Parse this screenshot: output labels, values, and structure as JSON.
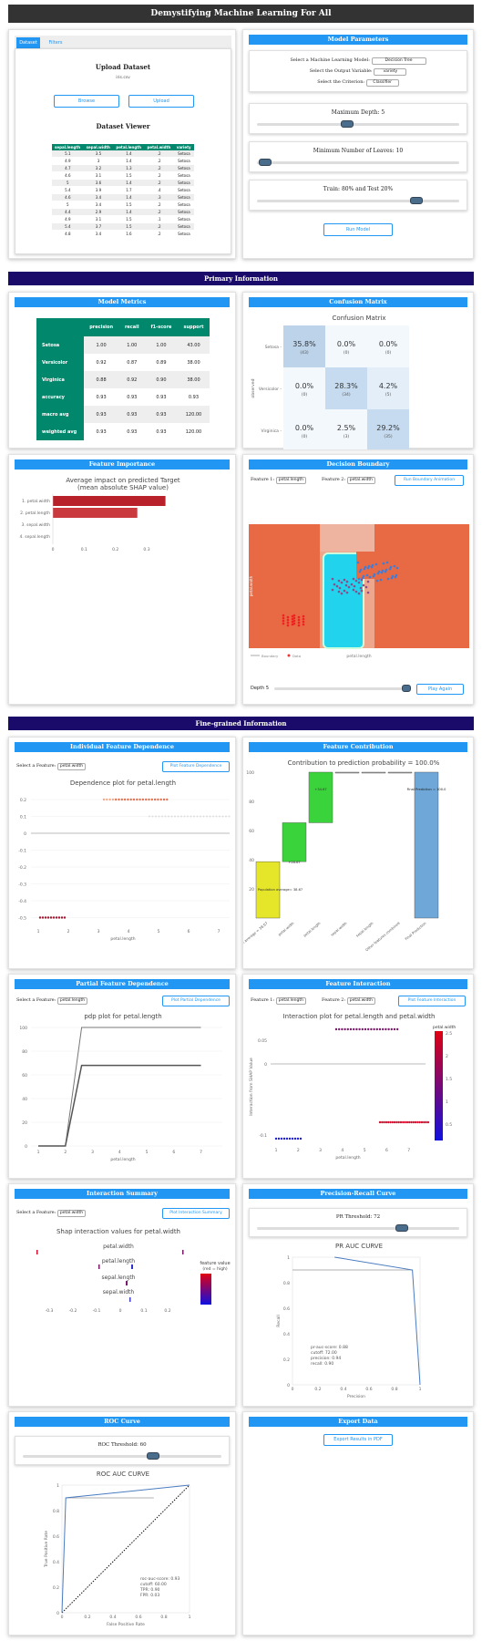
{
  "app": {
    "title": "Demystifying Machine Learning For All"
  },
  "sections": {
    "primary": "Primary Information",
    "fine": "Fine-grained Information"
  },
  "dataset": {
    "tab_dataset": "Dataset",
    "tab_filters": "Filters",
    "upload_title": "Upload Dataset",
    "filename": "iris.csv",
    "browse": "Browse",
    "upload": "Upload",
    "viewer_title": "Dataset Viewer",
    "columns": [
      "sepal.length",
      "sepal.width",
      "petal.length",
      "petal.width",
      "variety"
    ],
    "rows": [
      [
        "5.1",
        "3.5",
        "1.4",
        ".2",
        "Setosa"
      ],
      [
        "4.9",
        "3",
        "1.4",
        ".2",
        "Setosa"
      ],
      [
        "4.7",
        "3.2",
        "1.3",
        ".2",
        "Setosa"
      ],
      [
        "4.6",
        "3.1",
        "1.5",
        ".2",
        "Setosa"
      ],
      [
        "5",
        "3.6",
        "1.4",
        ".2",
        "Setosa"
      ],
      [
        "5.4",
        "3.9",
        "1.7",
        ".4",
        "Setosa"
      ],
      [
        "4.6",
        "3.4",
        "1.4",
        ".3",
        "Setosa"
      ],
      [
        "5",
        "3.4",
        "1.5",
        ".2",
        "Setosa"
      ],
      [
        "4.4",
        "2.9",
        "1.4",
        ".2",
        "Setosa"
      ],
      [
        "4.9",
        "3.1",
        "1.5",
        ".1",
        "Setosa"
      ],
      [
        "5.4",
        "3.7",
        "1.5",
        ".2",
        "Setosa"
      ],
      [
        "4.8",
        "3.4",
        "1.6",
        ".2",
        "Setosa"
      ]
    ]
  },
  "params": {
    "title": "Model Parameters",
    "model_label": "Select a Machine Learning Model:",
    "model_value": "Decision Tree",
    "output_label": "Select the Output Variable:",
    "output_value": "variety",
    "criterion_label": "Select the Criterion:",
    "criterion_value": "Classifier",
    "depth_label": "Maximum Depth: 5",
    "leaves_label": "Minimum Number of Leaves: 10",
    "split_label": "Train: 80% and Test 20%",
    "run": "Run Model",
    "depth_value": 5,
    "leaves_value": 10,
    "train_pct": 80
  },
  "metrics": {
    "title": "Model Metrics",
    "headers": [
      "",
      "precision",
      "recall",
      "f1-score",
      "support"
    ],
    "rows": [
      [
        "Setosa",
        "1.00",
        "1.00",
        "1.00",
        "43.00"
      ],
      [
        "Versicolor",
        "0.92",
        "0.87",
        "0.89",
        "38.00"
      ],
      [
        "Virginica",
        "0.88",
        "0.92",
        "0.90",
        "38.00"
      ],
      [
        "accuracy",
        "0.93",
        "0.93",
        "0.93",
        "0.93"
      ],
      [
        "macro avg",
        "0.93",
        "0.93",
        "0.93",
        "120.00"
      ],
      [
        "weighted avg",
        "0.93",
        "0.93",
        "0.93",
        "120.00"
      ]
    ]
  },
  "confusion": {
    "title": "Confusion Matrix",
    "chart_title": "Confusion Matrix",
    "ylabel": "observed",
    "xlabel": "predicted",
    "labels": [
      "Setosa",
      "Versicolor",
      "Virginica"
    ],
    "cells": [
      [
        "35.8%",
        "(43)",
        "0.0%",
        "(0)",
        "0.0%",
        "(0)"
      ],
      [
        "0.0%",
        "(0)",
        "28.3%",
        "(34)",
        "4.2%",
        "(5)"
      ],
      [
        "0.0%",
        "(0)",
        "2.5%",
        "(3)",
        "29.2%",
        "(35)"
      ]
    ]
  },
  "importance": {
    "title": "Feature Importance",
    "chart_title1": "Average impact on predicted Target",
    "chart_title2": "(mean absolute SHAP value)",
    "features": [
      "1. petal.width",
      "2. petal.length",
      "3. sepal.width",
      "4. sepal.length"
    ],
    "ticks": [
      "0",
      "0.1",
      "0.2",
      "0.3"
    ]
  },
  "boundary": {
    "title": "Decision Boundary",
    "f1_label": "Feature 1:",
    "f1_value": "petal.length",
    "f2_label": "Feature 2:",
    "f2_value": "petal.width",
    "run_anim": "Run Boundary Animation",
    "ylabel": "petal.width",
    "xlabel": "petal.length",
    "legend1": "Boundary",
    "legend2": "Data",
    "depth_label": "Depth 5",
    "play": "Play Again"
  },
  "dependence": {
    "title": "Individual Feature Dependence",
    "select_label": "Select a Feature:",
    "select_value": "petal.width",
    "plot_btn": "Plot Feature Dependence",
    "chart_title": "Dependence plot for petal.length",
    "xlabel": "petal.length",
    "yticks": [
      "0.2",
      "0.1",
      "0",
      "-0.1",
      "-0.2",
      "-0.3",
      "-0.4",
      "-0.5"
    ],
    "xticks": [
      "1",
      "2",
      "3",
      "4",
      "5",
      "6",
      "7"
    ]
  },
  "contribution": {
    "title": "Feature Contribution",
    "chart_title": "Contribution to prediction probability = 100.0%",
    "yticks": [
      "100",
      "80",
      "60",
      "40",
      "20"
    ],
    "bars": [
      "Population average = 38.67",
      "petal.width",
      "petal.length",
      "sepal.width",
      "sepal.length",
      "Other features combined",
      "Final Prediction"
    ],
    "inlabels": [
      "Population average= 38.67",
      "+26.67",
      "+34.67",
      "Final Prediction = 100.0"
    ]
  },
  "pdp": {
    "title": "Partial Feature Dependence",
    "select_label": "Select a Feature:",
    "select_value": "petal.length",
    "plot_btn": "Plot Partial Dependence",
    "chart_title": "pdp plot for petal.length",
    "xlabel": "petal.length",
    "yticks": [
      "100",
      "80",
      "60",
      "40",
      "20",
      "0"
    ],
    "xticks": [
      "1",
      "2",
      "3",
      "4",
      "5",
      "6",
      "7"
    ]
  },
  "interaction": {
    "title": "Feature Interaction",
    "f1_label": "Feature 1:",
    "f1_value": "petal.length",
    "f2_label": "Feature 2:",
    "f2_value": "petal.width",
    "plot_btn": "Plot Feature Interaction",
    "chart_title": "Interaction plot for petal.length and petal.width",
    "ylabel": "Interaction from SHAP Value",
    "xlabel": "petal.length",
    "legend_title": "petal.width",
    "xticks": [
      "1",
      "2",
      "3",
      "4",
      "5",
      "6",
      "7"
    ],
    "yticks": [
      "0.05",
      "0",
      "-0.1"
    ],
    "cticks": [
      "2.5",
      "2",
      "1.5",
      "1",
      "0.5"
    ]
  },
  "summary": {
    "title": "Interaction Summary",
    "select_label": "Select a Feature:",
    "select_value": "petal.width",
    "plot_btn": "Plot Interaction Summary",
    "chart_title": "Shap interaction values for petal.width",
    "features": [
      "petal.width",
      "petal.length",
      "sepal.length",
      "sepal.width"
    ],
    "legend1": "feature value",
    "legend2": "(red = high)",
    "xticks": [
      "-0.3",
      "-0.2",
      "-0.1",
      "0",
      "0.1",
      "0.2"
    ]
  },
  "pr": {
    "title": "Precision-Recall Curve",
    "threshold_label": "PR Threshold: 72",
    "threshold": 72,
    "chart_title": "PR AUC CURVE",
    "xlabel": "Precision",
    "ylabel": "Recall",
    "stats": [
      "pr-auc-score: 0.88",
      "cutoff: 72.00",
      "precision: 0.94",
      "recall: 0.90"
    ],
    "xticks": [
      "0",
      "0.2",
      "0.4",
      "0.6",
      "0.8",
      "1"
    ],
    "yticks": [
      "1",
      "0.8",
      "0.6",
      "0.4",
      "0.2",
      "0"
    ]
  },
  "roc": {
    "title": "ROC Curve",
    "threshold_label": "ROC Threshold: 60",
    "threshold": 60,
    "chart_title": "ROC AUC CURVE",
    "xlabel": "False Positive Rate",
    "ylabel": "True Positive Rate",
    "stats": [
      "roc-auc-score: 0.93",
      "cutoff: 60.00",
      "TPR: 0.90",
      "FPR: 0.03"
    ],
    "xticks": [
      "0",
      "0.2",
      "0.4",
      "0.6",
      "0.8",
      "1"
    ],
    "yticks": [
      "1",
      "0.8",
      "0.6",
      "0.4",
      "0.2",
      "0"
    ]
  },
  "export": {
    "title": "Export Data",
    "button": "Export Results in PDF"
  },
  "colors": {
    "accent": "#2196f3",
    "section": "#1a0b6b",
    "teal": "#00876c",
    "brick": "#e76a44",
    "cyan": "#21d3ec"
  }
}
